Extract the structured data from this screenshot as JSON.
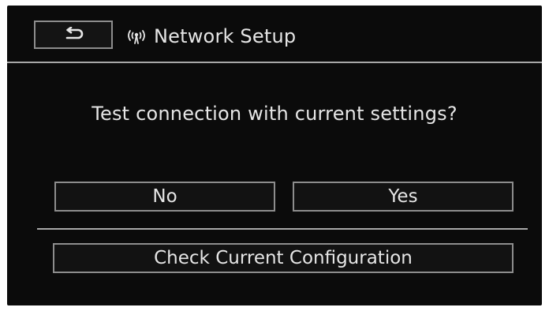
{
  "header": {
    "back_icon": "return-arrow-icon",
    "network_icon": "wireless-antenna-icon",
    "title": "Network Setup"
  },
  "dialog": {
    "question": "Test connection with current settings?",
    "no_label": "No",
    "yes_label": "Yes",
    "check_label": "Check Current Configuration"
  },
  "colors": {
    "background": "#0b0b0b",
    "text": "#e6e6e6",
    "button_border": "#8d8d8d",
    "divider": "#a8a8a8"
  }
}
